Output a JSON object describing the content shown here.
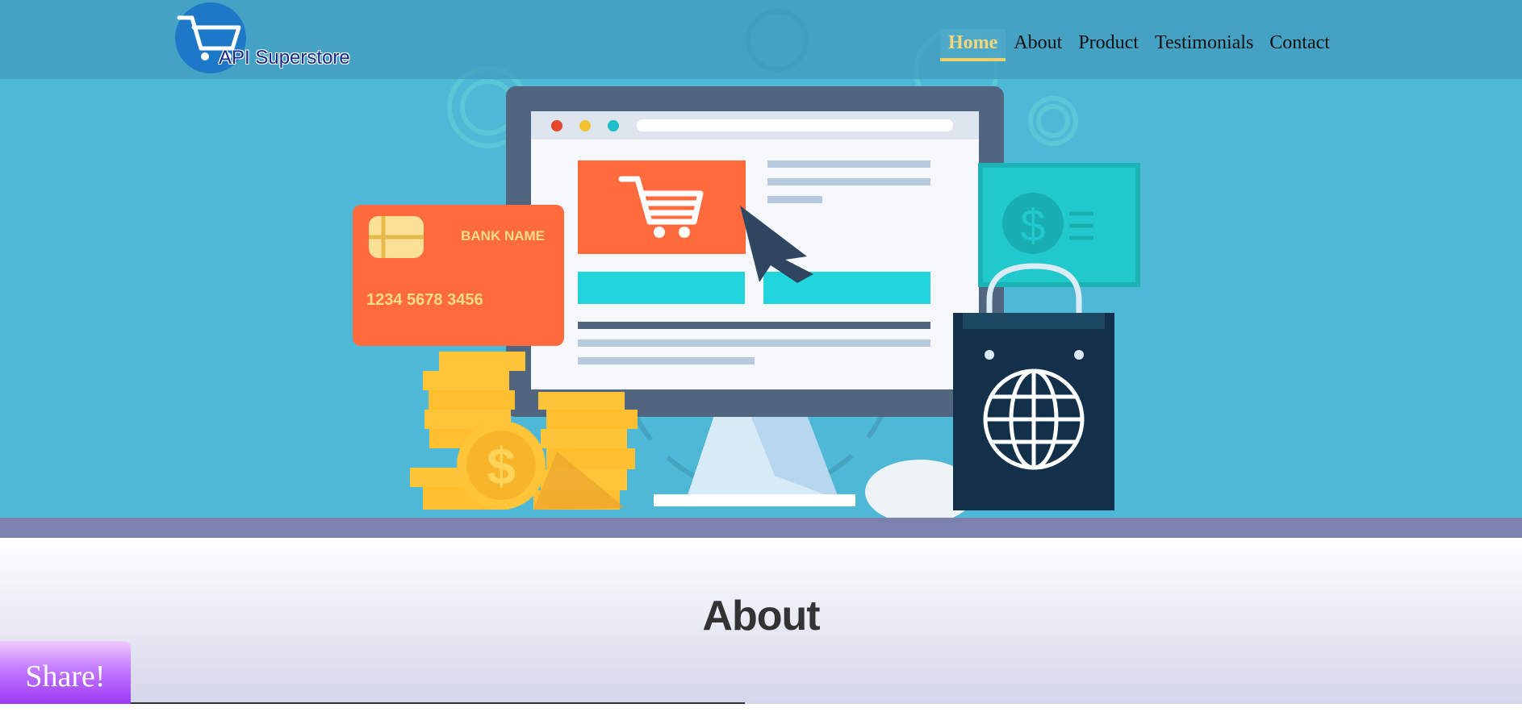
{
  "brand": {
    "name": "API Superstore"
  },
  "nav": {
    "items": [
      {
        "label": "Home",
        "active": true
      },
      {
        "label": "About",
        "active": false
      },
      {
        "label": "Product",
        "active": false
      },
      {
        "label": "Testimonials",
        "active": false
      },
      {
        "label": "Contact",
        "active": false
      }
    ]
  },
  "hero": {
    "card_bank": "BANK NAME",
    "card_number": "1234  5678  3456",
    "dollar_symbol": "$"
  },
  "about": {
    "title": "About"
  },
  "share": {
    "label": "Share!"
  },
  "colors": {
    "hero_bg": "#4fb8d6",
    "nav_active": "#f5d77a",
    "band": "#7d81b0",
    "card": "#ff6b3d",
    "share_bg": "#c27aff"
  },
  "icons": [
    "cart-icon",
    "credit-card-icon",
    "coin-icon",
    "shopping-bag-icon",
    "globe-icon",
    "monitor-icon",
    "cursor-icon",
    "banknote-icon"
  ]
}
